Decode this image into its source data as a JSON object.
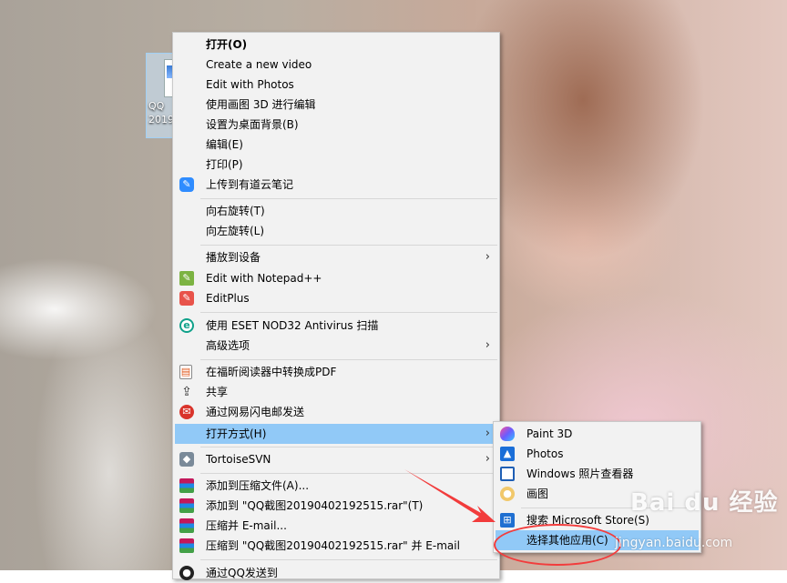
{
  "desktop_icon": {
    "name": "QQ\n2019"
  },
  "context_menu": {
    "items": [
      {
        "label": "打开(O)",
        "bold": true
      },
      {
        "label": "Create a new video"
      },
      {
        "label": "Edit with Photos"
      },
      {
        "label": "使用画图 3D 进行编辑"
      },
      {
        "label": "设置为桌面背景(B)"
      },
      {
        "label": "编辑(E)"
      },
      {
        "label": "打印(P)"
      },
      {
        "label": "上传到有道云笔记",
        "icon": "youdao-note-icon"
      },
      {
        "label": "向右旋转(T)"
      },
      {
        "label": "向左旋转(L)"
      },
      {
        "label": "播放到设备",
        "submenu": true
      },
      {
        "label": "Edit with Notepad++",
        "icon": "notepadpp-icon"
      },
      {
        "label": "EditPlus",
        "icon": "editplus-icon"
      },
      {
        "label": "使用 ESET NOD32 Antivirus 扫描",
        "icon": "eset-icon"
      },
      {
        "label": "高级选项",
        "submenu": true
      },
      {
        "label": "在福昕阅读器中转换成PDF",
        "icon": "foxit-pdf-icon"
      },
      {
        "label": "共享",
        "icon": "share-icon"
      },
      {
        "label": "通过网易闪电邮发送",
        "icon": "netease-flash-mail-icon"
      },
      {
        "label": "打开方式(H)",
        "submenu": true,
        "highlighted": true
      },
      {
        "label": "TortoiseSVN",
        "icon": "tortoisesvn-icon",
        "submenu": true
      },
      {
        "label": "添加到压缩文件(A)...",
        "icon": "winrar-icon"
      },
      {
        "label": "添加到 \"QQ截图20190402192515.rar\"(T)",
        "icon": "winrar-icon"
      },
      {
        "label": "压缩并 E-mail...",
        "icon": "winrar-icon"
      },
      {
        "label": "压缩到 \"QQ截图20190402192515.rar\" 并 E-mail",
        "icon": "winrar-icon"
      },
      {
        "label": "通过QQ发送到",
        "icon": "qq-icon"
      }
    ]
  },
  "open_with_submenu": {
    "items": [
      {
        "label": "Paint 3D",
        "icon": "paint3d-icon"
      },
      {
        "label": "Photos",
        "icon": "photos-icon"
      },
      {
        "label": "Windows 照片查看器",
        "icon": "windows-photo-viewer-icon"
      },
      {
        "label": "画图",
        "icon": "mspaint-icon"
      },
      {
        "label": "搜索 Microsoft Store(S)",
        "icon": "microsoft-store-icon"
      },
      {
        "label": "选择其他应用(C)",
        "highlighted": true
      }
    ]
  },
  "watermark": {
    "brand": "Bai du 经验",
    "url": "jingyan.baidu.com"
  },
  "colors": {
    "highlight": "#91c9f7",
    "menu_bg": "#f2f2f2",
    "annotation_red": "#f23c3c"
  }
}
